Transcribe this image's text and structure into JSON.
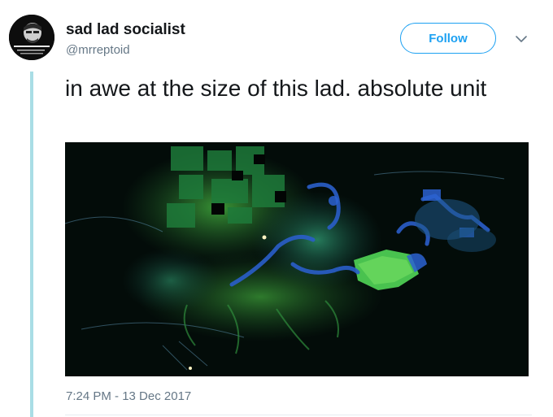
{
  "tweet": {
    "author": {
      "display_name": "sad lad socialist",
      "username": "@mrreptoid"
    },
    "follow_label": "Follow",
    "text": "in awe at the size of this lad. absolute unit",
    "timestamp": "7:24 PM - 13 Dec 2017",
    "media": {
      "description_icon": "lidar-scan-image"
    }
  },
  "colors": {
    "accent": "#1da1f2",
    "text_primary": "#14171a",
    "text_secondary": "#657786",
    "thread_line": "#a9dde5"
  }
}
